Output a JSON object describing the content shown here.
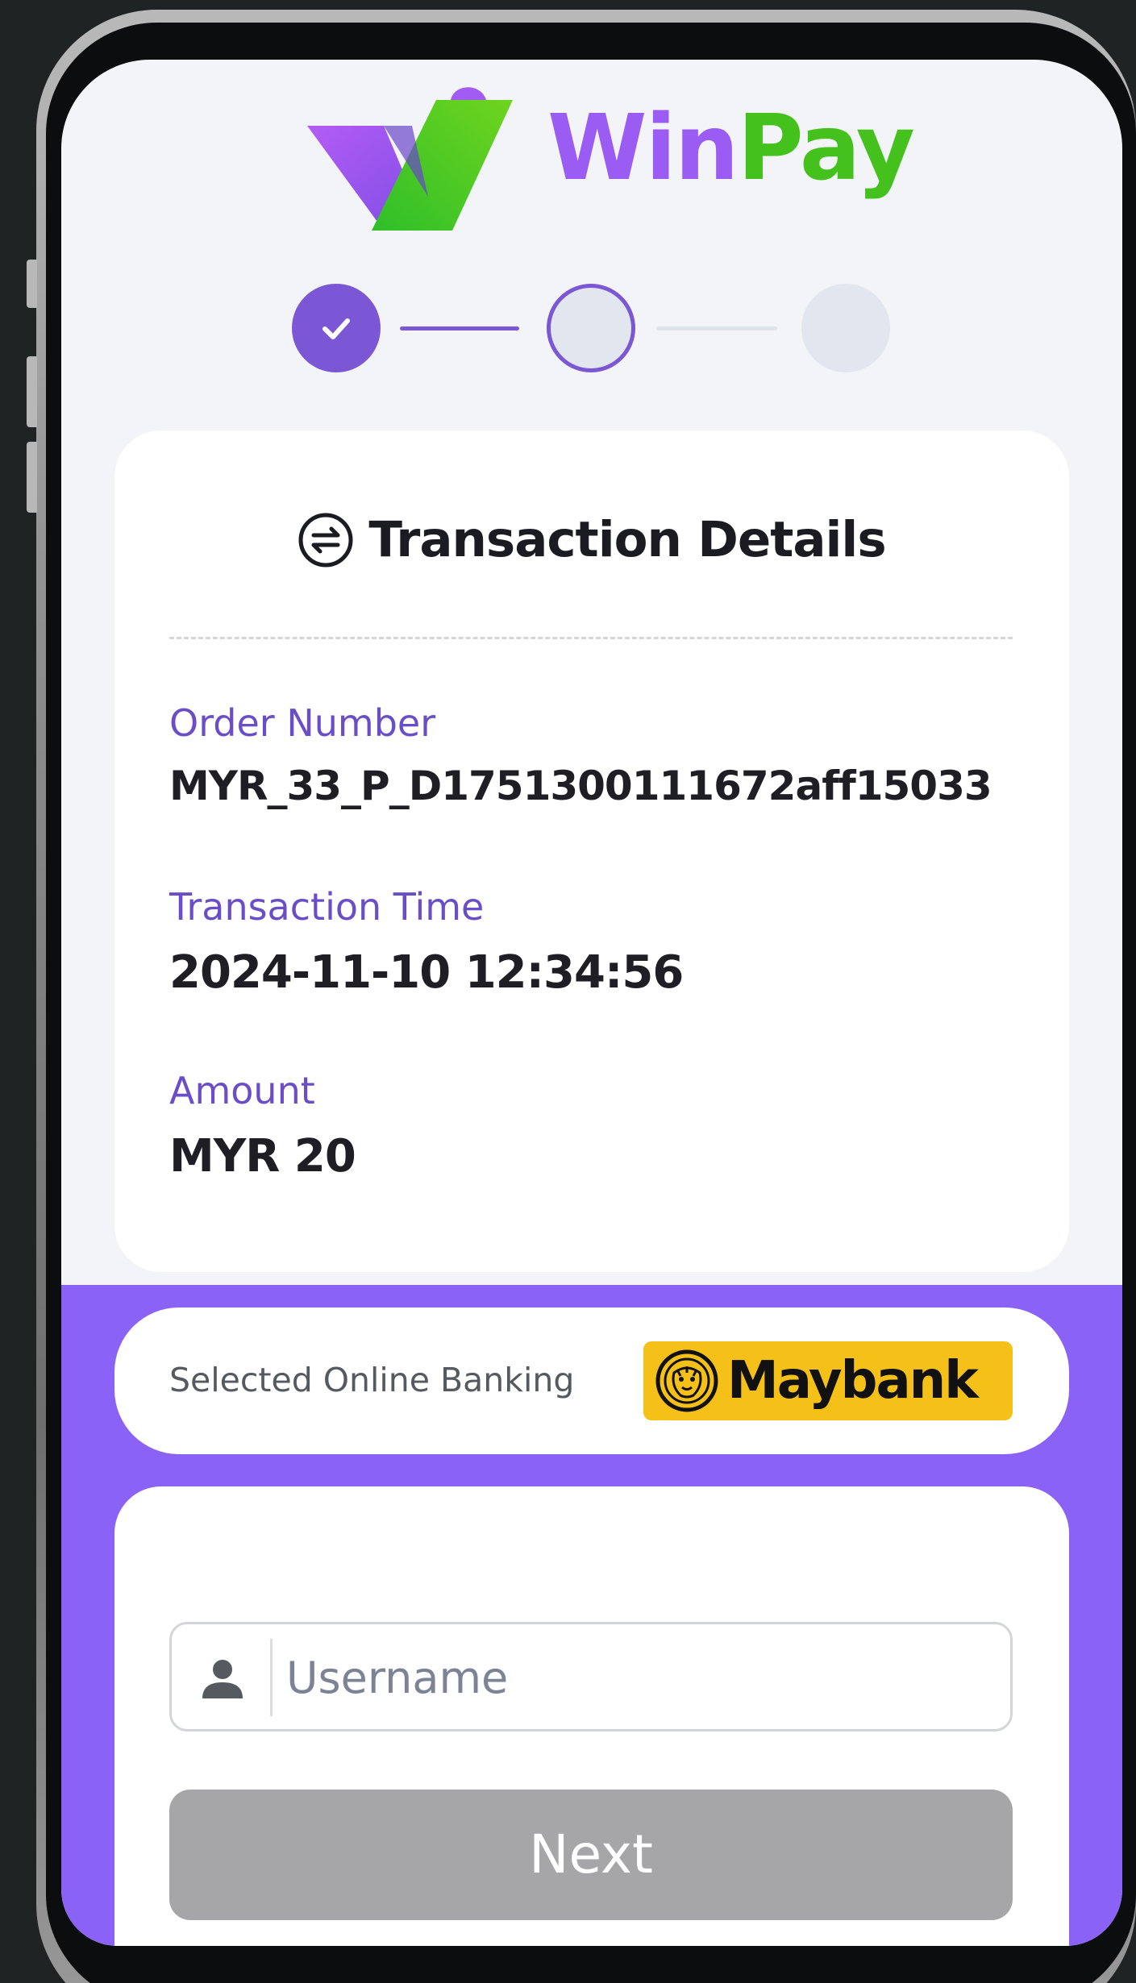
{
  "brand": {
    "name_part1": "Win",
    "name_part2": "Pay",
    "purple": "#9a5cf2",
    "green": "#45c11e"
  },
  "stepper": {
    "steps": [
      {
        "state": "completed",
        "icon": "check-icon"
      },
      {
        "state": "current"
      },
      {
        "state": "upcoming"
      }
    ],
    "accent": "#7b57d6"
  },
  "transaction": {
    "title": "Transaction Details",
    "title_icon": "swap-arrows-icon",
    "order_number_label": "Order Number",
    "order_number_value": "MYR_33_P_D1751300111672aff15033",
    "time_label": "Transaction Time",
    "time_value": "2024-11-10 12:34:56",
    "amount_label": "Amount",
    "amount_value": "MYR 20"
  },
  "banking": {
    "label": "Selected Online Banking",
    "bank_name": "Maybank",
    "bank_icon": "tiger-icon",
    "bank_color": "#f5c018"
  },
  "login": {
    "username_placeholder": "Username",
    "username_icon": "user-icon",
    "next_label": "Next"
  },
  "theme": {
    "band_color": "#8a63f6",
    "screen_bg": "#f3f4f8"
  }
}
